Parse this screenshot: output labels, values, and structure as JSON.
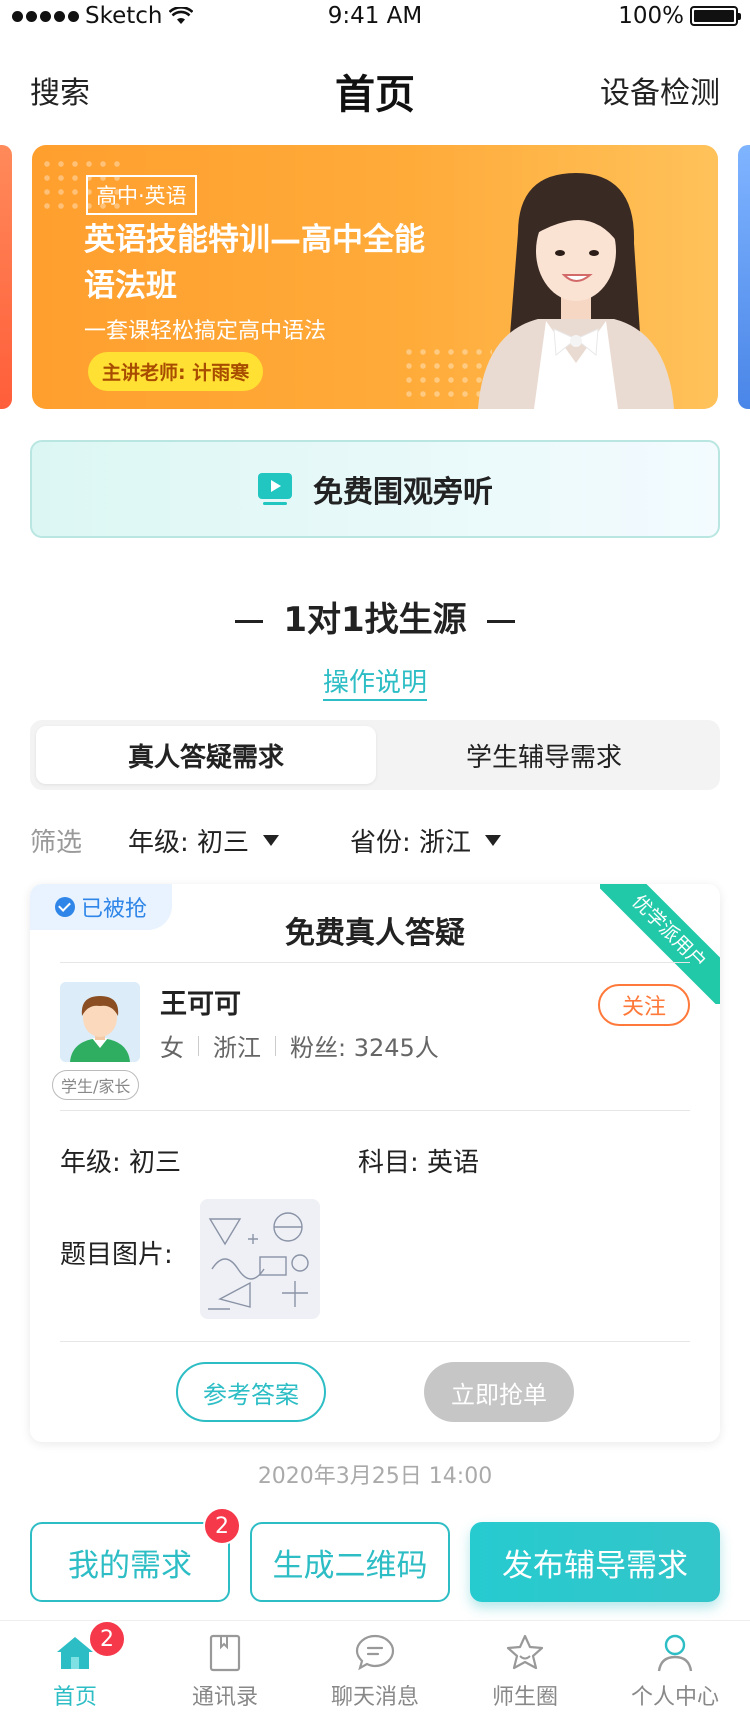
{
  "status_bar": {
    "carrier": "Sketch",
    "time": "9:41 AM",
    "battery": "100%"
  },
  "nav": {
    "left": "搜索",
    "title": "首页",
    "right": "设备检测"
  },
  "banner": {
    "tag": "高中·英语",
    "title": "英语技能特训—高中全能语法班",
    "subtitle": "一套课轻松搞定高中语法",
    "teacher": "主讲老师: 计雨寒"
  },
  "free_listen": {
    "label": "免费围观旁听",
    "icon": "video-play-icon"
  },
  "section": {
    "title": "1对1找生源",
    "link": "操作说明"
  },
  "tabs": [
    {
      "label": "真人答疑需求",
      "active": true
    },
    {
      "label": "学生辅导需求",
      "active": false
    }
  ],
  "filter": {
    "label": "筛选",
    "grade": "年级: 初三",
    "province": "省份: 浙江"
  },
  "card": {
    "status": "已被抢",
    "title": "免费真人答疑",
    "ribbon": "优学派用户",
    "user": {
      "name": "王可可",
      "gender": "女",
      "province": "浙江",
      "fans": "粉丝: 3245人",
      "role": "学生/家长"
    },
    "follow": "关注",
    "grade": "年级: 初三",
    "subject": "科目: 英语",
    "image_label": "题目图片:",
    "btn_answer": "参考答案",
    "btn_grab": "立即抢单"
  },
  "timestamp": "2020年3月25日 14:00",
  "actions": {
    "my_demand": "我的需求",
    "my_demand_badge": "2",
    "qr_code": "生成二维码",
    "publish": "发布辅导需求"
  },
  "tabbar": {
    "items": [
      {
        "label": "首页",
        "icon": "home-icon",
        "active": true,
        "badge": "2"
      },
      {
        "label": "通讯录",
        "icon": "contacts-book-icon",
        "active": false
      },
      {
        "label": "聊天消息",
        "icon": "chat-bubble-icon",
        "active": false
      },
      {
        "label": "师生圈",
        "icon": "star-icon",
        "active": false
      },
      {
        "label": "个人中心",
        "icon": "person-icon",
        "active": false
      }
    ]
  },
  "colors": {
    "accent": "#2dbdc5",
    "orange": "#ff7a3a",
    "badge": "#f5384a",
    "banner": "#ffab3a"
  }
}
